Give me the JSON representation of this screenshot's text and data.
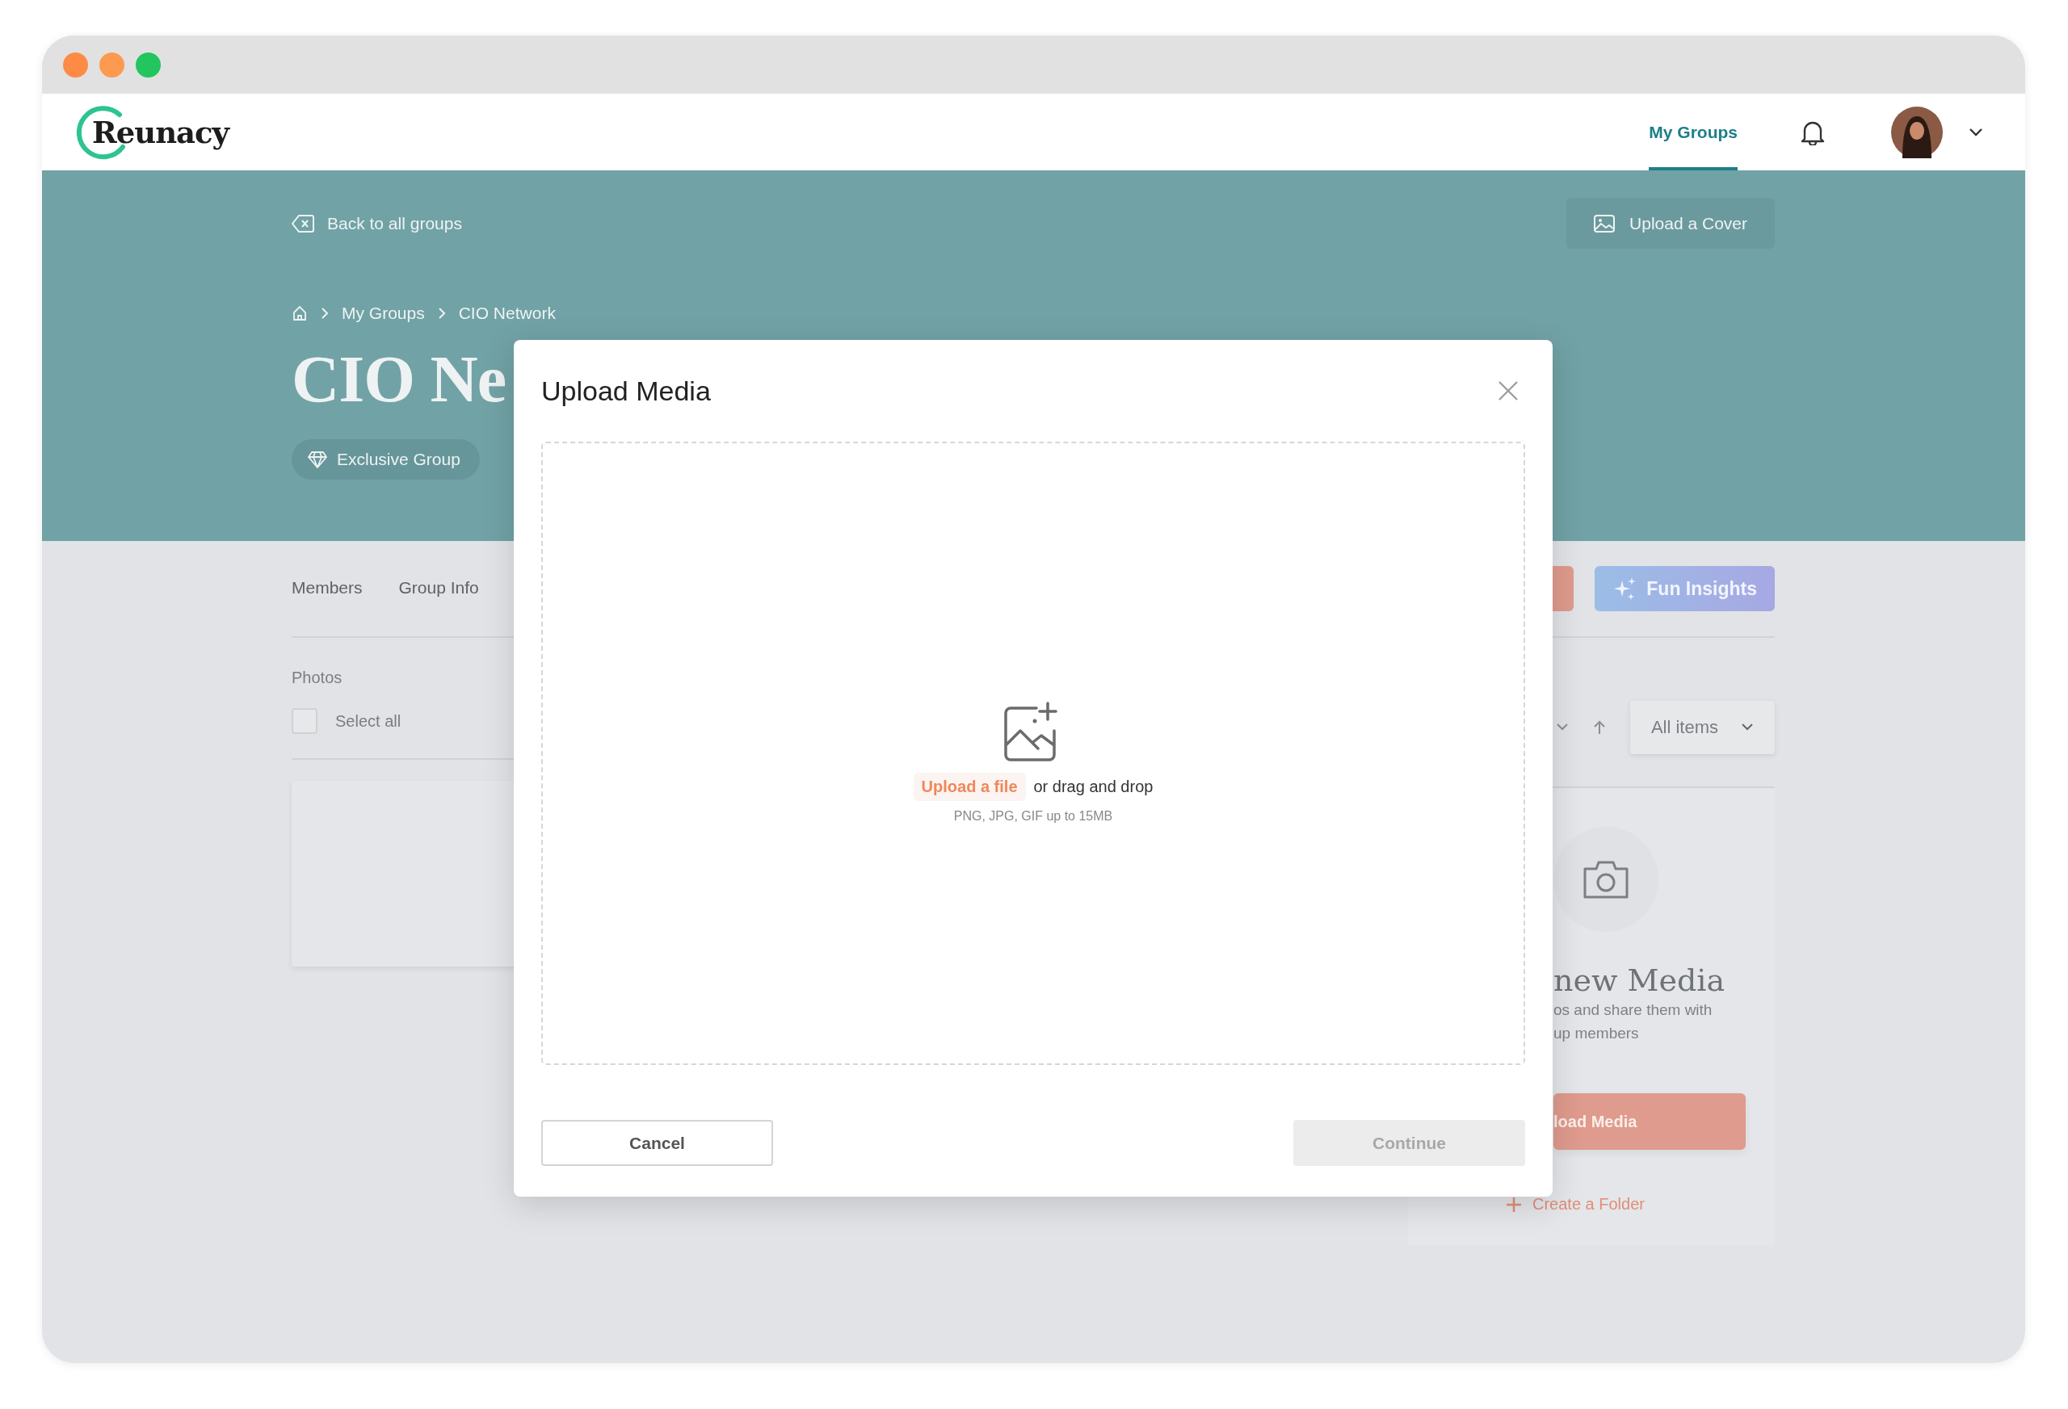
{
  "app": {
    "logo": "Reunacy",
    "nav": [
      {
        "label": "My Groups",
        "selected": true
      }
    ]
  },
  "banner": {
    "back_link": "Back to all groups",
    "upload_cover": "Upload a Cover",
    "breadcrumb": [
      "My Groups",
      "CIO Network"
    ],
    "title": "CIO Ne",
    "badges": [
      "Exclusive Group"
    ]
  },
  "tabs": [
    {
      "label": "Members",
      "selected": false
    },
    {
      "label": "Group Info",
      "selected": false
    }
  ],
  "fun_insights": "Fun Insights",
  "photos": {
    "heading": "Photos",
    "select_all": {
      "label": "Select all",
      "checked": false
    },
    "filter": "All items"
  },
  "empty_state": {
    "heading": "new Media",
    "description": [
      "os and share them with",
      "up members"
    ],
    "button": "load Media",
    "create_folder": "Create a Folder"
  },
  "modal": {
    "title": "Upload Media",
    "upload_link": "Upload a file",
    "drop_text": "or drag and drop",
    "hint": "PNG, JPG, GIF up to 15MB",
    "cancel": "Cancel",
    "continue": {
      "label": "Continue",
      "disabled": true
    }
  }
}
